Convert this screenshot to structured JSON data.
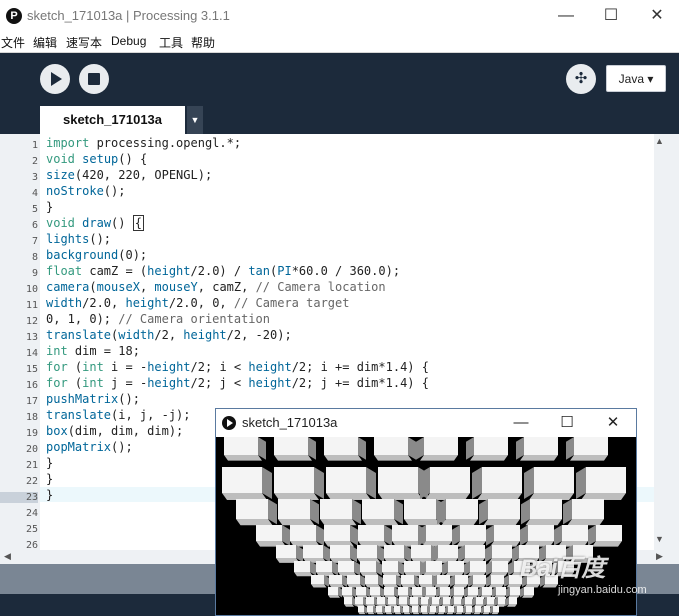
{
  "window": {
    "title": "sketch_171013a | Processing 3.1.1",
    "app_icon_glyph": "P",
    "minimize": "—",
    "maximize": "☐",
    "close": "✕"
  },
  "menu": {
    "items": [
      "文件",
      "编辑",
      "速写本",
      "Debug",
      "工具",
      "帮助"
    ]
  },
  "toolbar": {
    "mode_label": "Java ▾"
  },
  "tabs": {
    "active_label": "sketch_171013a",
    "menu_glyph": "▼"
  },
  "editor": {
    "line_numbers": [
      "1",
      "2",
      "3",
      "4",
      "5",
      "6",
      "7",
      "8",
      "9",
      "10",
      "11",
      "12",
      "13",
      "14",
      "15",
      "16",
      "17",
      "18",
      "19",
      "20",
      "21",
      "22",
      "23",
      "24",
      "25",
      "26"
    ],
    "lines": [
      [
        {
          "t": "import",
          "c": "kw"
        },
        {
          "t": " processing.opengl.*;",
          "c": ""
        }
      ],
      [
        {
          "t": "void",
          "c": "kw"
        },
        {
          "t": " ",
          "c": ""
        },
        {
          "t": "setup",
          "c": "fn"
        },
        {
          "t": "() {",
          "c": ""
        }
      ],
      [
        {
          "t": "size",
          "c": "fn"
        },
        {
          "t": "(420, 220, OPENGL);",
          "c": ""
        }
      ],
      [
        {
          "t": "noStroke",
          "c": "fn"
        },
        {
          "t": "();",
          "c": ""
        }
      ],
      [
        {
          "t": "}",
          "c": ""
        }
      ],
      [
        {
          "t": "void",
          "c": "kw"
        },
        {
          "t": " ",
          "c": ""
        },
        {
          "t": "draw",
          "c": "fn"
        },
        {
          "t": "() ",
          "c": ""
        },
        {
          "t": "{",
          "c": "box"
        }
      ],
      [
        {
          "t": "lights",
          "c": "fn"
        },
        {
          "t": "();",
          "c": ""
        }
      ],
      [
        {
          "t": "background",
          "c": "fn"
        },
        {
          "t": "(0);",
          "c": ""
        }
      ],
      [
        {
          "t": "float",
          "c": "kw"
        },
        {
          "t": " camZ = (",
          "c": ""
        },
        {
          "t": "height",
          "c": "fn"
        },
        {
          "t": "/2.0) / ",
          "c": ""
        },
        {
          "t": "tan",
          "c": "fn"
        },
        {
          "t": "(",
          "c": ""
        },
        {
          "t": "PI",
          "c": "fn"
        },
        {
          "t": "*60.0 / 360.0);",
          "c": ""
        }
      ],
      [
        {
          "t": "camera",
          "c": "fn"
        },
        {
          "t": "(",
          "c": ""
        },
        {
          "t": "mouseX",
          "c": "fn"
        },
        {
          "t": ", ",
          "c": ""
        },
        {
          "t": "mouseY",
          "c": "fn"
        },
        {
          "t": ", camZ, ",
          "c": ""
        },
        {
          "t": "// Camera location",
          "c": "cm"
        }
      ],
      [
        {
          "t": "width",
          "c": "fn"
        },
        {
          "t": "/2.0, ",
          "c": ""
        },
        {
          "t": "height",
          "c": "fn"
        },
        {
          "t": "/2.0, 0, ",
          "c": ""
        },
        {
          "t": "// Camera target",
          "c": "cm"
        }
      ],
      [
        {
          "t": "0, 1, 0); ",
          "c": ""
        },
        {
          "t": "// Camera orientation",
          "c": "cm"
        }
      ],
      [
        {
          "t": "translate",
          "c": "fn"
        },
        {
          "t": "(",
          "c": ""
        },
        {
          "t": "width",
          "c": "fn"
        },
        {
          "t": "/2, ",
          "c": ""
        },
        {
          "t": "height",
          "c": "fn"
        },
        {
          "t": "/2, -20);",
          "c": ""
        }
      ],
      [
        {
          "t": "int",
          "c": "kw"
        },
        {
          "t": " dim = 18;",
          "c": ""
        }
      ],
      [
        {
          "t": "for",
          "c": "kw"
        },
        {
          "t": " (",
          "c": ""
        },
        {
          "t": "int",
          "c": "kw"
        },
        {
          "t": " i = -",
          "c": ""
        },
        {
          "t": "height",
          "c": "fn"
        },
        {
          "t": "/2; i < ",
          "c": ""
        },
        {
          "t": "height",
          "c": "fn"
        },
        {
          "t": "/2; i += dim*1.4) {",
          "c": ""
        }
      ],
      [
        {
          "t": "for",
          "c": "kw"
        },
        {
          "t": " (",
          "c": ""
        },
        {
          "t": "int",
          "c": "kw"
        },
        {
          "t": " j = -",
          "c": ""
        },
        {
          "t": "height",
          "c": "fn"
        },
        {
          "t": "/2; j < ",
          "c": ""
        },
        {
          "t": "height",
          "c": "fn"
        },
        {
          "t": "/2; j += dim*1.4) {",
          "c": ""
        }
      ],
      [
        {
          "t": "pushMatrix",
          "c": "fn"
        },
        {
          "t": "();",
          "c": ""
        }
      ],
      [
        {
          "t": "translate",
          "c": "fn"
        },
        {
          "t": "(i, j, -j);",
          "c": ""
        }
      ],
      [
        {
          "t": "box",
          "c": "fn"
        },
        {
          "t": "(dim, dim, dim);",
          "c": ""
        }
      ],
      [
        {
          "t": "popMatrix",
          "c": "fn"
        },
        {
          "t": "();",
          "c": ""
        }
      ],
      [
        {
          "t": "}",
          "c": ""
        }
      ],
      [
        {
          "t": "}",
          "c": ""
        }
      ],
      [
        {
          "t": "}",
          "c": ""
        }
      ]
    ],
    "current_line": "23"
  },
  "sketch_window": {
    "title": "sketch_171013a",
    "minimize": "—",
    "maximize": "☐",
    "close": "✕"
  },
  "watermark": {
    "logo": "Bai百度",
    "subtitle": "jingyan.baidu.com"
  },
  "colors": {
    "background": "#1c2a3b",
    "keyword": "#33997e",
    "function": "#006699",
    "comment": "#666666"
  }
}
